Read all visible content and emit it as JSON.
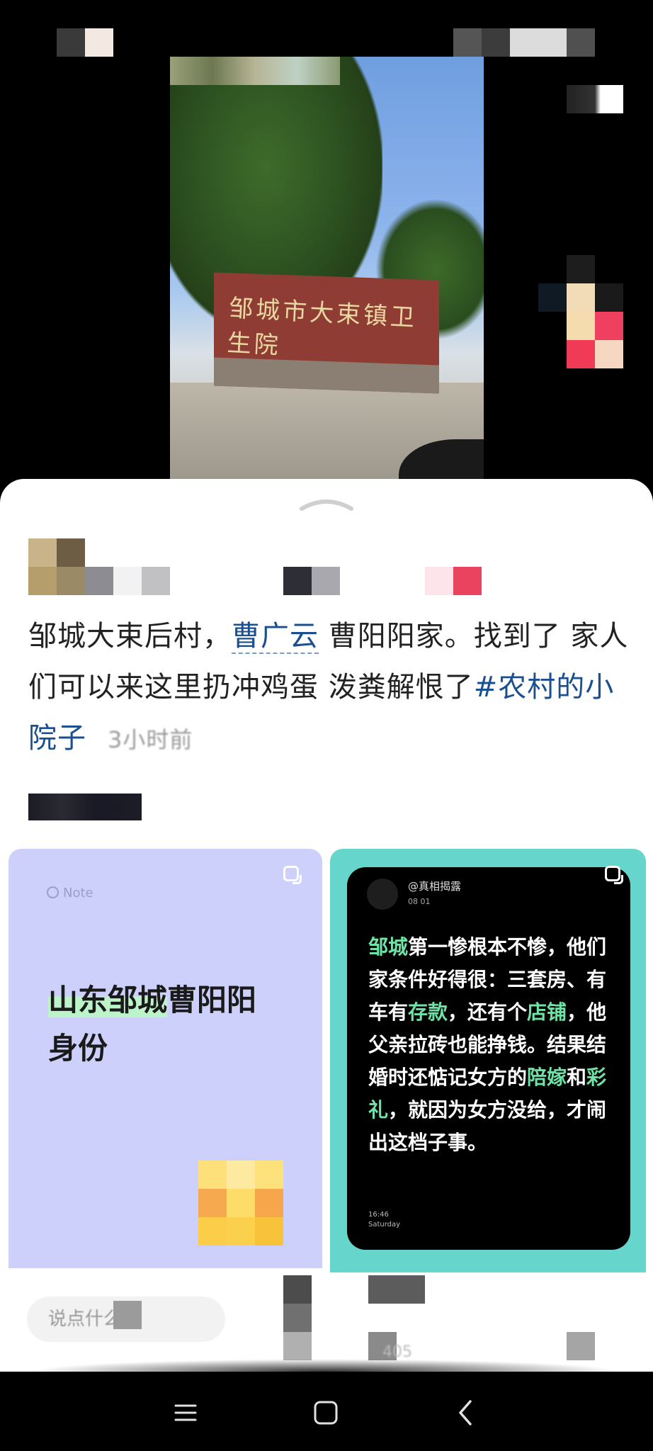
{
  "post": {
    "text_part1": "邹城大束后村，",
    "mention": "曹广云",
    "text_part2": " 曹阳阳家。找到了 家人们可以来这里扔冲鸡蛋 泼粪解恨了",
    "topic": "#农村的小院子",
    "time": "3小时前"
  },
  "photo": {
    "sign_text": "邹城市大束镇卫生院"
  },
  "card_left": {
    "note_label": "Note",
    "title_highlight": "山东邹城",
    "title_rest": "曹阳阳身份"
  },
  "card_right": {
    "handle": "@真相揭露",
    "date": "08 01",
    "t1": "邹城",
    "t2": "第一惨根本不惨，他们家条件好得很：三套房、有车有",
    "t3": "存款",
    "t4": "，还有个",
    "t5": "店铺",
    "t6": "，他父亲拉砖也能挣钱。结果结婚时还惦记女方的",
    "t7": "陪嫁",
    "t8": "和",
    "t9": "彩礼",
    "t10": "，就因为女方没给，才闹出这档子事。",
    "time": "16:46",
    "weekday": "Saturday"
  },
  "comment_bar": {
    "placeholder": "说点什么",
    "count": "405"
  },
  "colors": {
    "link": "#1b4f8f",
    "green_highlight": "#6fe3a5",
    "card_left_bg": "#ccd0fb",
    "card_right_bg": "#66d5cc"
  },
  "icons": [
    "menu-icon",
    "home-icon",
    "back-icon",
    "collapse-chevron-icon",
    "multi-image-icon"
  ]
}
